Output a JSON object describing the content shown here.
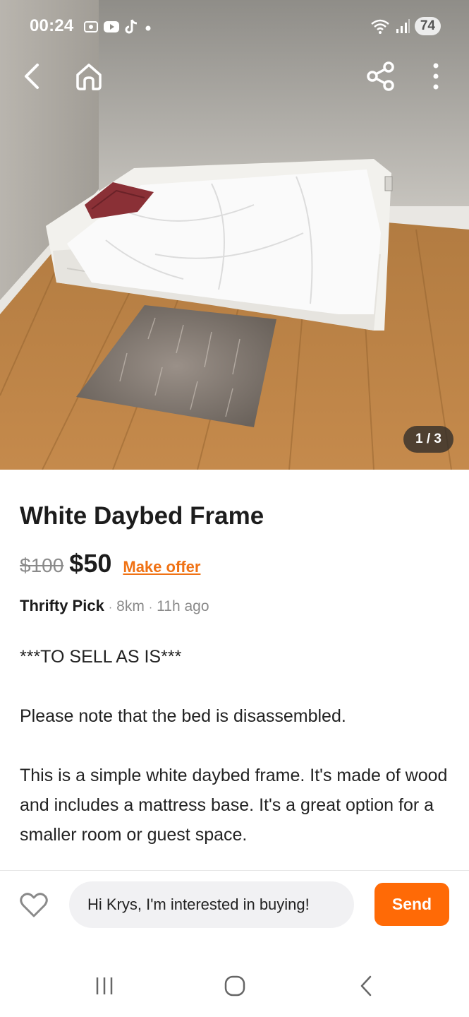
{
  "status_bar": {
    "time": "00:24",
    "battery": "74",
    "icons_left": [
      "screenshot-icon",
      "youtube-icon",
      "tiktok-icon",
      "notification-dot-icon"
    ],
    "icons_right": [
      "wifi-icon",
      "signal-icon"
    ]
  },
  "top_nav": {
    "icons": [
      "back-icon",
      "home-icon",
      "share-icon",
      "more-vert-icon"
    ]
  },
  "gallery": {
    "counter": "1 / 3"
  },
  "listing": {
    "title": "White Daybed Frame",
    "old_price": "$100",
    "price": "$50",
    "make_offer_label": "Make offer",
    "seller": "Thrifty Pick",
    "distance": "8km",
    "posted": "11h ago",
    "separator": "·",
    "description": [
      "***TO SELL AS  IS***",
      "Please note that the bed is disassembled.",
      "This is a simple white daybed frame. It's made of wood and includes a mattress base. It's a great option for a smaller room or guest space."
    ]
  },
  "action_bar": {
    "message_value": "Hi Krys, I'm interested in buying!",
    "send_label": "Send",
    "favorite_icon": "heart-outline-icon"
  },
  "system_nav": {
    "icons": [
      "recents-icon",
      "home-circle-icon",
      "back-chevron-icon"
    ]
  },
  "colors": {
    "accent": "#ff6a06",
    "link": "#f07214",
    "muted_text": "#8a8a8a"
  }
}
